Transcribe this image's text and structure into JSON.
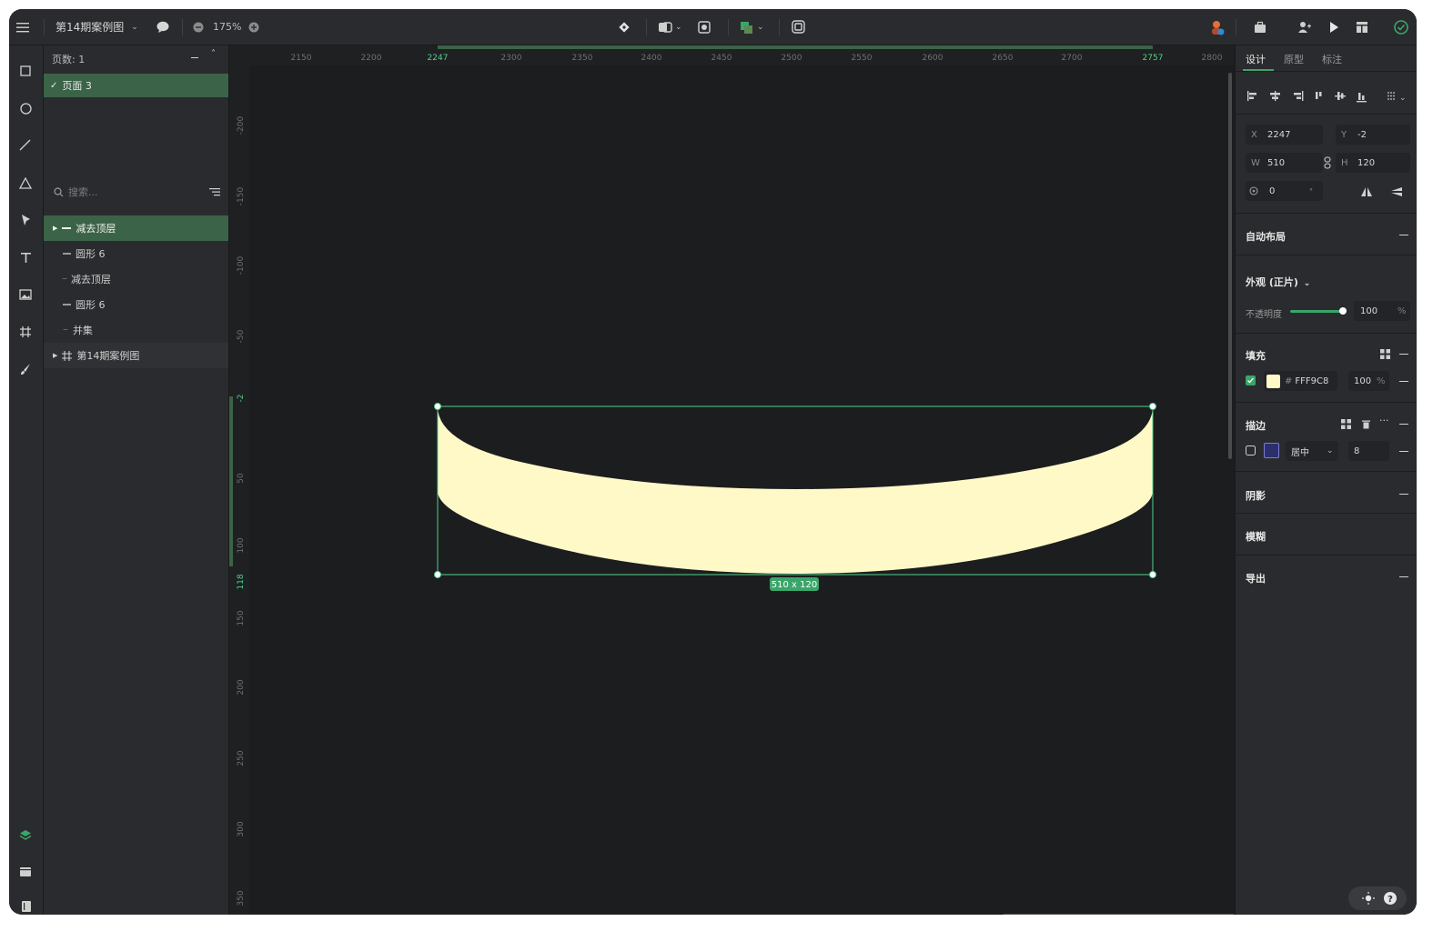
{
  "toolbar": {
    "doc_title": "第14期案例图",
    "zoom": "175%"
  },
  "layers_panel": {
    "pages_label": "页数: 1",
    "current_page": "页面 3",
    "search_placeholder": "搜索...",
    "items": [
      {
        "label": "减去顶层"
      },
      {
        "label": "圆形 6"
      },
      {
        "label": "减去顶层"
      },
      {
        "label": "圆形 6"
      },
      {
        "label": "并集"
      },
      {
        "label": "第14期案例图"
      }
    ]
  },
  "ruler": {
    "h_ticks": [
      "2150",
      "2200",
      "2247",
      "2300",
      "2350",
      "2400",
      "2450",
      "2500",
      "2550",
      "2600",
      "2650",
      "2700",
      "2757",
      "2800"
    ],
    "v_ticks": [
      "-200",
      "-150",
      "-100",
      "-50",
      "-2",
      "50",
      "100",
      "118",
      "150",
      "200",
      "250",
      "300",
      "350"
    ]
  },
  "canvas": {
    "size_badge": "510 x 120",
    "shape_fill": "#FFF9C8",
    "selection_color": "#4fd18b"
  },
  "right_panel": {
    "tabs": [
      "设计",
      "原型",
      "标注"
    ],
    "x_label": "X",
    "x_value": "2247",
    "y_label": "Y",
    "y_value": "-2",
    "w_label": "W",
    "w_value": "510",
    "h_label": "H",
    "h_value": "120",
    "rotation_value": "0",
    "auto_layout": "自动布局",
    "appearance": "外观 (正片)",
    "opacity_label": "不透明度",
    "opacity_value": "100",
    "opacity_unit": "%",
    "fill_title": "填充",
    "fill_hex_prefix": "#",
    "fill_hex": "FFF9C8",
    "fill_opacity": "100",
    "fill_unit": "%",
    "stroke_title": "描边",
    "stroke_position": "居中",
    "stroke_width": "8",
    "shadow_title": "阴影",
    "blur_title": "模糊",
    "export_title": "导出"
  },
  "colors": {
    "accent": "#3aa66a",
    "panel": "#2a2b2e",
    "canvas": "#1c1d1f"
  }
}
